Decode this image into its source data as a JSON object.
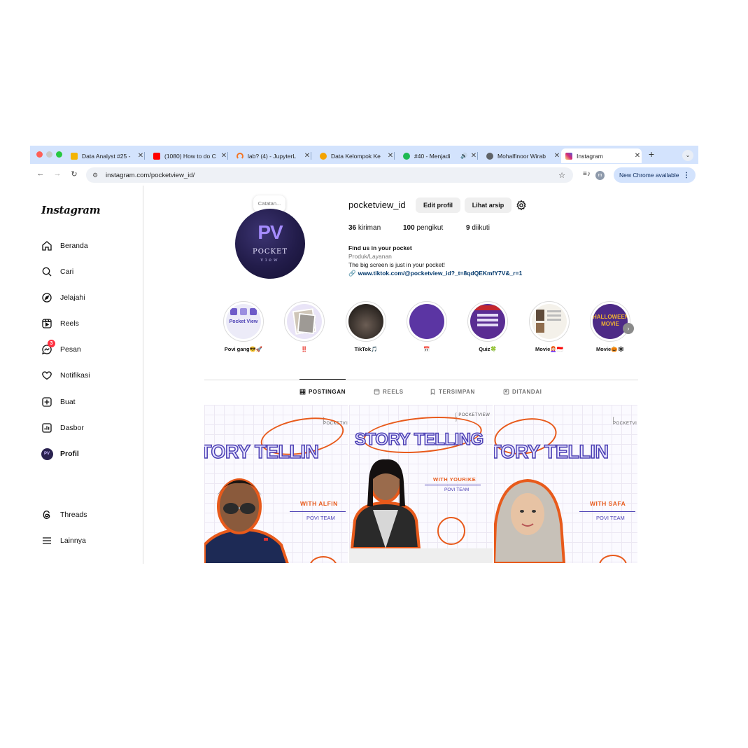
{
  "browser": {
    "tabs": [
      {
        "label": "Data Analyst #25 -",
        "favicon_color": "#f4b400"
      },
      {
        "label": "(1080) How to do C",
        "favicon_color": "#ff0000"
      },
      {
        "label": "lab? (4) - JupyterL",
        "favicon_color": "#f37626"
      },
      {
        "label": "Data Kelompok Ke",
        "favicon_color": "#f4a300"
      },
      {
        "label": "#40 - Menjadi",
        "favicon_color": "#1db954"
      },
      {
        "label": "Mohalfinoor Wirab",
        "favicon_color": "#5f6368"
      },
      {
        "label": "Instagram",
        "favicon_color": "#e1306c"
      }
    ],
    "new_tab_glyph": "+",
    "url": "instagram.com/pocketview_id/",
    "profile_initial": "m",
    "update_label": "New Chrome available"
  },
  "instagram": {
    "logo": "Instagram",
    "nav": [
      {
        "label": "Beranda",
        "icon": "home-icon"
      },
      {
        "label": "Cari",
        "icon": "search-icon"
      },
      {
        "label": "Jelajahi",
        "icon": "compass-icon"
      },
      {
        "label": "Reels",
        "icon": "reels-icon"
      },
      {
        "label": "Pesan",
        "icon": "messenger-icon",
        "badge": "3"
      },
      {
        "label": "Notifikasi",
        "icon": "heart-icon"
      },
      {
        "label": "Buat",
        "icon": "plus-square-icon"
      },
      {
        "label": "Dasbor",
        "icon": "dashboard-icon"
      },
      {
        "label": "Profil",
        "icon": "avatar"
      }
    ],
    "bottom_nav": [
      {
        "label": "Threads",
        "icon": "threads-icon"
      },
      {
        "label": "Lainnya",
        "icon": "menu-icon"
      }
    ],
    "profile": {
      "note": "Catatan...",
      "avatar_logo": "PV",
      "avatar_name": "POCKET",
      "avatar_sub": "view",
      "username": "pocketview_id",
      "edit_button": "Edit profil",
      "archive_button": "Lihat arsip",
      "stats": {
        "posts_count": "36",
        "posts_label": "kiriman",
        "followers_count": "100",
        "followers_label": "pengikut",
        "following_count": "9",
        "following_label": "diikuti"
      },
      "bio_name": "Find us in your pocket",
      "category": "Produk/Layanan",
      "bio": "The big screen is just in your pocket!",
      "link": "www.tiktok.com/@pocketview_id?_t=8qdQEKmfY7V&_r=1"
    },
    "highlights": [
      {
        "label": "Povi gang😎🚀",
        "art": "Pocket View"
      },
      {
        "label": "‼️"
      },
      {
        "label": "TikTok🎵"
      },
      {
        "label": "📅"
      },
      {
        "label": "Quiz🍀"
      },
      {
        "label": "Movie👩🏻‍🦰🇮🇩"
      },
      {
        "label": "Movie🎃🕸",
        "art": "HALLOWEEN MOVIE"
      }
    ],
    "profile_tabs": [
      "POSTINGAN",
      "REELS",
      "TERSIMPAN",
      "DITANDAI"
    ],
    "posts": [
      {
        "tag": "[ POCKETVIEW",
        "title": "TORY TELLIN",
        "with": "WITH ALFIN",
        "team": "POVI TEAM"
      },
      {
        "tag": "[ POCKETVIEW ]",
        "title": "STORY TELLING",
        "with": "WITH YOURIKE",
        "team": "POVI TEAM"
      },
      {
        "tag": "[ POCKETVI",
        "title": "TORY TELLIN",
        "with": "WITH SAFA",
        "team": "POVI TEAM"
      }
    ],
    "colors": {
      "accent_purple": "#4b3fb4",
      "accent_orange": "#e85a1b",
      "badge_red": "#ff3040"
    }
  }
}
